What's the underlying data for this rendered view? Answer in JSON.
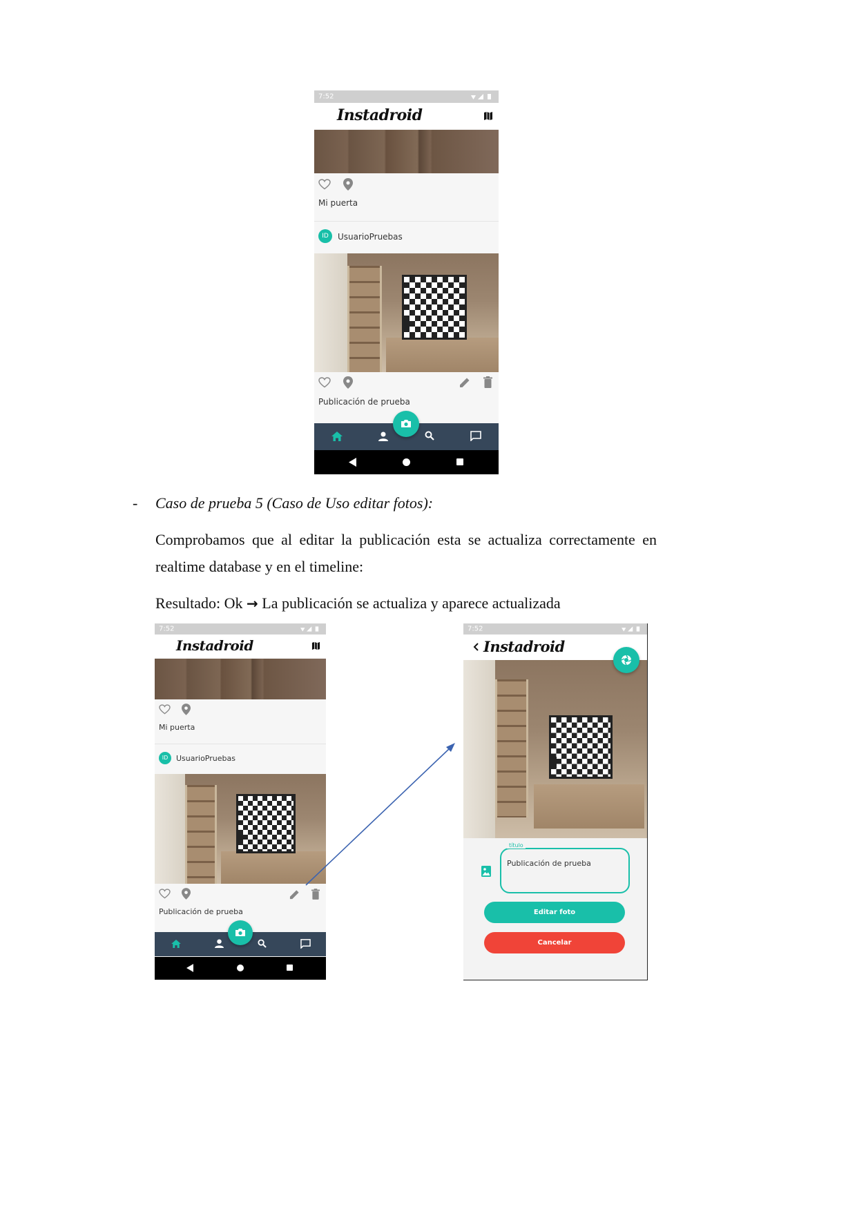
{
  "doc": {
    "bullet": "-",
    "case_title": "Caso de prueba 5 (Caso de Uso editar fotos):",
    "para_line1": "Comprobamos que al editar la publicación esta se actualiza correctamente en",
    "para_line2": "realtime database y en el timeline:",
    "result_prefix": "Resultado: Ok",
    "result_arrow": "→",
    "result_rest": "La publicación se actualiza y aparece actualizada"
  },
  "feed": {
    "status_time": "7:52",
    "app_title": "Instadroid",
    "post1_caption": "Mi puerta",
    "avatar_initials": "ID",
    "username": "UsuarioPruebas",
    "post2_caption": "Publicación de prueba"
  },
  "edit": {
    "status_time": "7:52",
    "app_title": "Instadroid",
    "field_label": "título",
    "field_value": "Publicación de prueba",
    "edit_button": "Editar foto",
    "cancel_button": "Cancelar"
  },
  "colors": {
    "accent": "#19bfa9",
    "cancel": "#f04438",
    "bottom_nav": "#36475a",
    "arrow": "#3b63b0"
  },
  "icons": [
    "heart-icon",
    "location-pin-icon",
    "pencil-icon",
    "trash-icon",
    "camera-icon",
    "home-icon",
    "person-icon",
    "search-icon",
    "chat-icon",
    "map-icon",
    "back-chevron-icon",
    "shutter-icon",
    "image-icon"
  ]
}
